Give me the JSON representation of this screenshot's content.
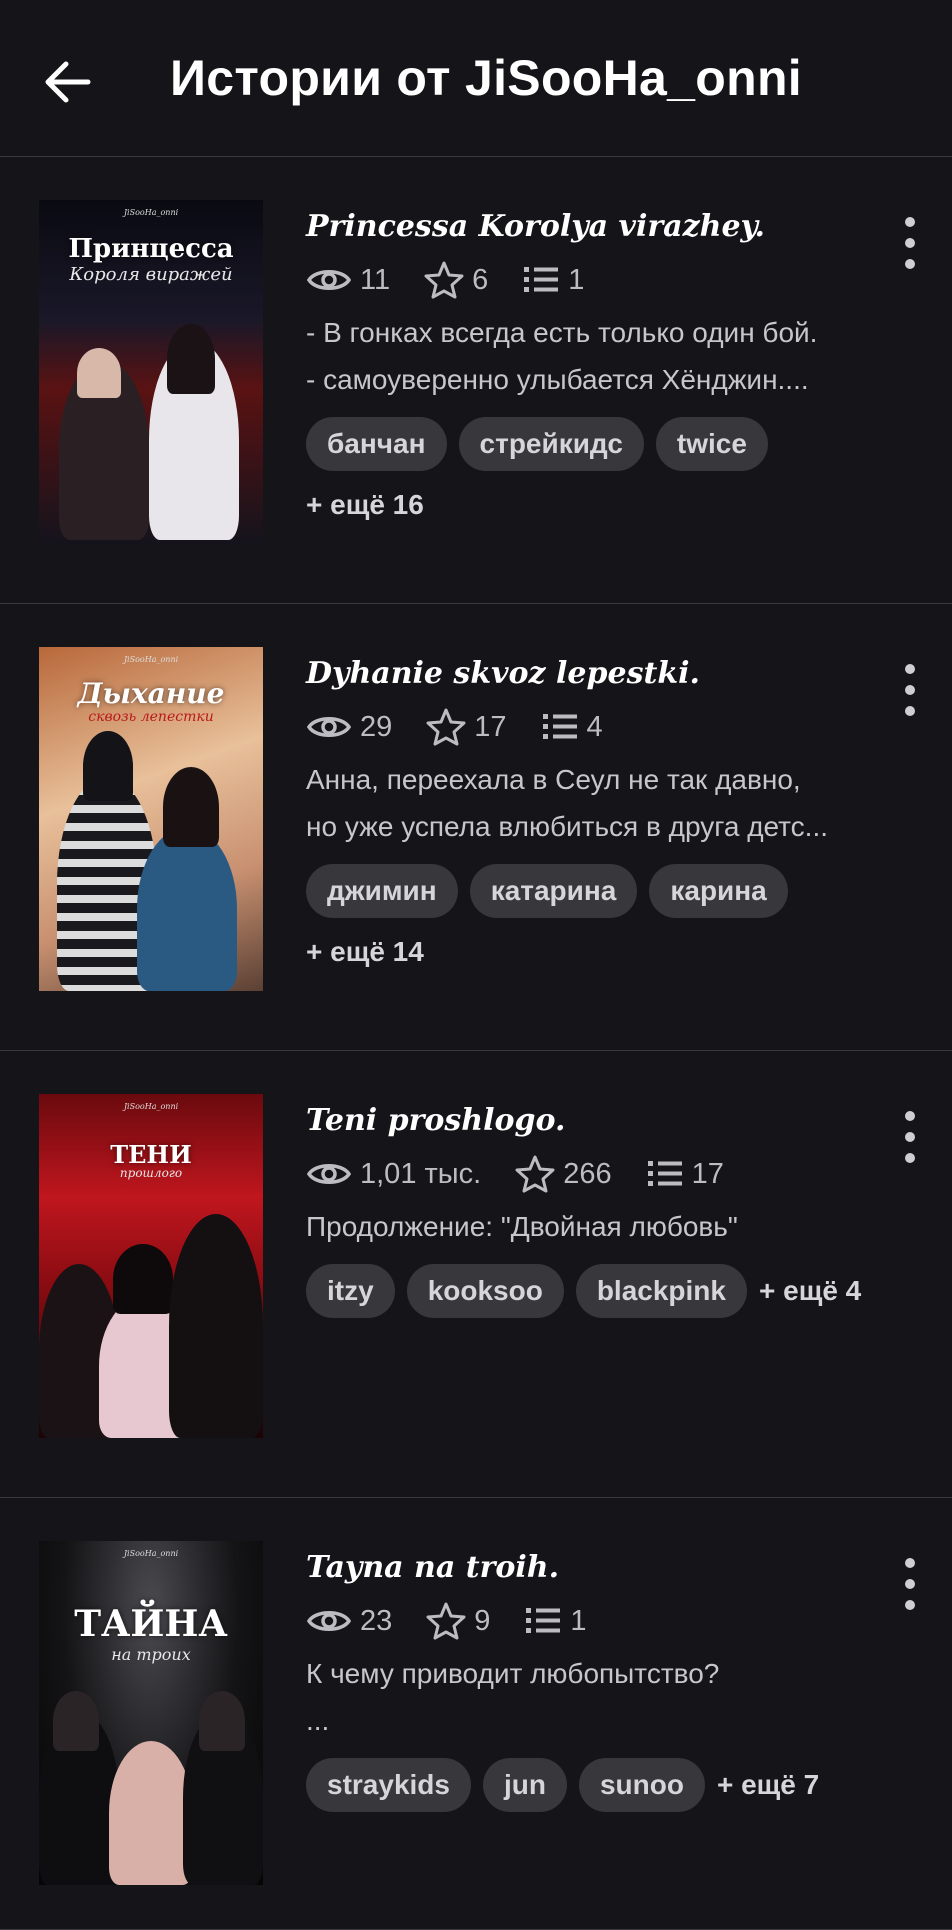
{
  "header": {
    "title": "Истории от JiSooHa_onni"
  },
  "stories": [
    {
      "title": "Princessa Korolya virazhey.",
      "views": "11",
      "stars": "6",
      "parts": "1",
      "desc1": "- В гонках всегда есть только один бой.",
      "desc2": "- самоуверенно улыбается Хёнджин....",
      "tags": [
        "банчан",
        "стрейкидс",
        "twice"
      ],
      "more": "+ ещё 16",
      "cover": {
        "title": "Принцесса",
        "subtitle": "Короля виражей",
        "author": "JiSooHa_onni",
        "colors": [
          "#0b0b10",
          "#1c1a2a",
          "#7a1a1a"
        ]
      }
    },
    {
      "title": "Dyhanie skvoz lepestki.",
      "views": "29",
      "stars": "17",
      "parts": "4",
      "desc1": "Анна, переехала в Сеул не так давно,",
      "desc2": "но уже успела влюбиться в друга детс...",
      "tags": [
        "джимин",
        "катарина",
        "карина"
      ],
      "more": "+ ещё 14",
      "cover": {
        "title": "Дыхание",
        "subtitle": "сквозь лепестки",
        "author": "JiSooHa_onni",
        "colors": [
          "#c8784a",
          "#e8b88a",
          "#6a4a3a"
        ]
      }
    },
    {
      "title": "Teni proshlogo.",
      "views": "1,01 тыс.",
      "stars": "266",
      "parts": "17",
      "desc1": "Продолжение: \"Двойная любовь\"",
      "desc2": "",
      "tags": [
        "itzy",
        "kooksoo",
        "blackpink"
      ],
      "more": "+ ещё 4",
      "cover": {
        "title": "ТЕНИ",
        "subtitle": "прошлого",
        "author": "JiSooHa_onni",
        "colors": [
          "#8a0c12",
          "#c0161e",
          "#2a0608"
        ]
      }
    },
    {
      "title": "Tayna na troih.",
      "views": "23",
      "stars": "9",
      "parts": "1",
      "desc1": "К чему приводит любопытство?",
      "desc2": "...",
      "tags": [
        "straykids",
        "jun",
        "sunoo"
      ],
      "more": "+ ещё 7",
      "cover": {
        "title": "ТАЙНА",
        "subtitle": "на троих",
        "author": "JiSooHa_onni",
        "colors": [
          "#050505",
          "#3a3a3e",
          "#101010"
        ]
      }
    }
  ]
}
